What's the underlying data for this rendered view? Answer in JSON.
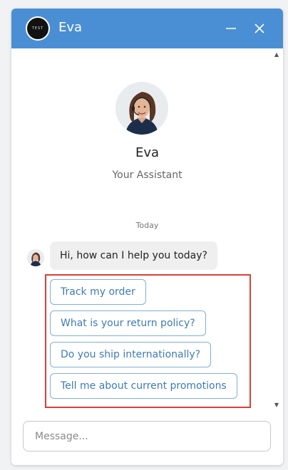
{
  "header": {
    "logo_text": "TEST",
    "title": "Eva",
    "minimize_icon": "minus-icon",
    "close_icon": "close-icon",
    "color": "#4a8fd4"
  },
  "profile": {
    "name": "Eva",
    "role": "Your Assistant"
  },
  "conversation": {
    "date_label": "Today",
    "messages": [
      {
        "from": "bot",
        "text": "Hi, how can I help you today?"
      }
    ],
    "quick_replies": [
      "Track my order",
      "What is your return policy?",
      "Do you ship internationally?",
      "Tell me about current promotions"
    ]
  },
  "composer": {
    "placeholder": "Message..."
  },
  "colors": {
    "accent": "#4a8fd4",
    "quick_reply_text": "#3e7bb6",
    "highlight_border": "#d9403a"
  }
}
